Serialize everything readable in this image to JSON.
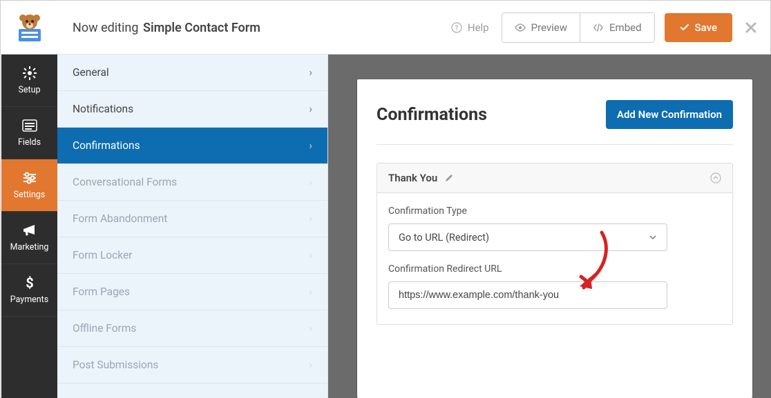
{
  "header": {
    "editing_label": "Now editing",
    "form_title": "Simple Contact Form",
    "help_label": "Help",
    "preview_label": "Preview",
    "embed_label": "Embed",
    "save_label": "Save"
  },
  "vnav": {
    "items": [
      {
        "label": "Setup",
        "icon": "gear-icon"
      },
      {
        "label": "Fields",
        "icon": "list-icon"
      },
      {
        "label": "Settings",
        "icon": "sliders-icon"
      },
      {
        "label": "Marketing",
        "icon": "megaphone-icon"
      },
      {
        "label": "Payments",
        "icon": "dollar-icon"
      }
    ]
  },
  "submenu": {
    "items": [
      {
        "label": "General"
      },
      {
        "label": "Notifications"
      },
      {
        "label": "Confirmations"
      },
      {
        "label": "Conversational Forms"
      },
      {
        "label": "Form Abandonment"
      },
      {
        "label": "Form Locker"
      },
      {
        "label": "Form Pages"
      },
      {
        "label": "Offline Forms"
      },
      {
        "label": "Post Submissions"
      }
    ]
  },
  "main": {
    "heading": "Confirmations",
    "add_button": "Add New Confirmation",
    "panel": {
      "title": "Thank You",
      "type_label": "Confirmation Type",
      "type_value": "Go to URL (Redirect)",
      "url_label": "Confirmation Redirect URL",
      "url_value": "https://www.example.com/thank-you"
    }
  }
}
